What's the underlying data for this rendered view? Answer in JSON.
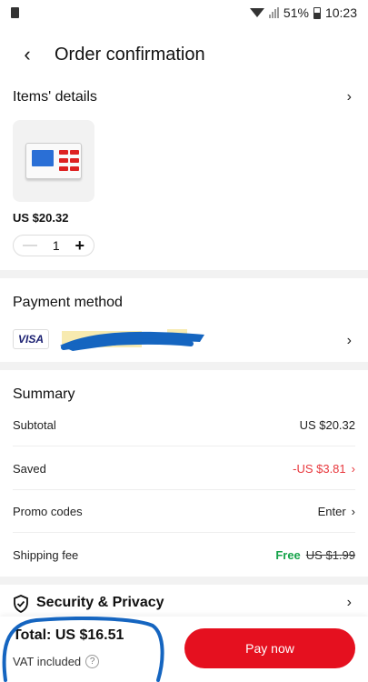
{
  "status_bar": {
    "battery": "51%",
    "time": "10:23"
  },
  "header": {
    "title": "Order confirmation"
  },
  "items": {
    "title": "Items' details",
    "product": {
      "price": "US $20.32",
      "quantity": "1"
    }
  },
  "payment": {
    "title": "Payment method",
    "card_brand": "VISA"
  },
  "summary": {
    "title": "Summary",
    "subtotal": {
      "label": "Subtotal",
      "value": "US $20.32"
    },
    "saved": {
      "label": "Saved",
      "value": "-US $3.81"
    },
    "promo": {
      "label": "Promo codes",
      "value": "Enter"
    },
    "shipping": {
      "label": "Shipping fee",
      "free": "Free",
      "original": "US $1.99"
    }
  },
  "security": {
    "title": "Security & Privacy"
  },
  "footer": {
    "total_label": "Total:",
    "total_value": "US $16.51",
    "vat": "VAT included",
    "pay_button": "Pay now"
  },
  "colors": {
    "accent": "#e5101f",
    "saved": "#e8383d",
    "free": "#16a34a",
    "redaction": "#1565c0"
  }
}
